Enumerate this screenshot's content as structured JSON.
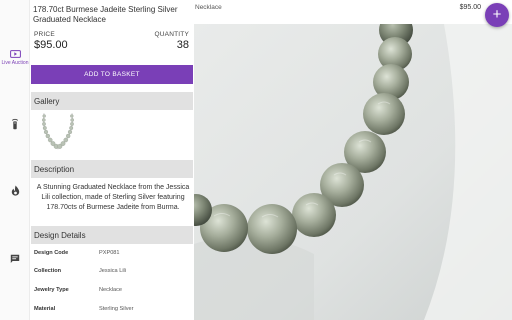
{
  "rail": {
    "items": [
      {
        "icon": "live-tv-icon",
        "label": "Live Auction"
      },
      {
        "icon": "remote-icon",
        "label": ""
      },
      {
        "icon": "flame-icon",
        "label": ""
      },
      {
        "icon": "chat-icon",
        "label": ""
      }
    ]
  },
  "product": {
    "title": "178.70ct Burmese Jadeite Sterling Silver Graduated Necklace",
    "price_label": "PRICE",
    "price": "$95.00",
    "quantity_label": "QUANTITY",
    "quantity": "38",
    "basket_button": "ADD TO BASKET"
  },
  "gallery": {
    "heading": "Gallery",
    "thumb_icon": "necklace-thumbnail"
  },
  "description": {
    "heading": "Description",
    "text": "A Stunning Graduated Necklace from the Jessica Lili collection, made of Sterling Silver featuring 178.70cts of Burmese Jadeite from Burma."
  },
  "design_details": {
    "heading": "Design Details",
    "rows": [
      {
        "key": "Design Code",
        "value": "PXP081"
      },
      {
        "key": "Collection",
        "value": "Jessica Lili"
      },
      {
        "key": "Jewelry Type",
        "value": "Necklace"
      },
      {
        "key": "Material",
        "value": "Sterling Silver"
      }
    ]
  },
  "topbar": {
    "breadcrumb": "Necklace",
    "price": "$95.00",
    "fab_symbol": "+"
  },
  "colors": {
    "accent": "#7a3fb7",
    "section_bg": "#e1e1e1"
  }
}
